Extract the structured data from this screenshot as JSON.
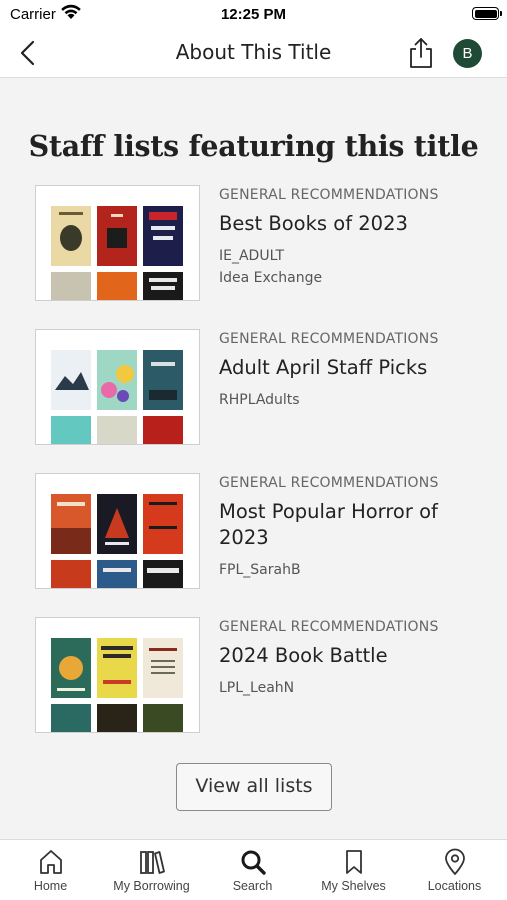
{
  "status_bar": {
    "carrier": "Carrier",
    "time": "12:25 PM"
  },
  "nav": {
    "title": "About This Title",
    "avatar_initial": "B"
  },
  "section": {
    "title": "Staff lists featuring this title"
  },
  "lists": [
    {
      "category": "GENERAL RECOMMENDATIONS",
      "title": "Best Books of 2023",
      "owner": "IE_ADULT",
      "owner_location": "Idea Exchange"
    },
    {
      "category": "GENERAL RECOMMENDATIONS",
      "title": "Adult April Staff Picks",
      "owner": "RHPLAdults"
    },
    {
      "category": "GENERAL RECOMMENDATIONS",
      "title": "Most Popular Horror of 2023",
      "owner": "FPL_SarahB"
    },
    {
      "category": "GENERAL RECOMMENDATIONS",
      "title": "2024 Book Battle",
      "owner": "LPL_LeahN"
    }
  ],
  "view_all_label": "View all lists",
  "tabs": [
    {
      "label": "Home",
      "icon": "home-icon"
    },
    {
      "label": "My Borrowing",
      "icon": "books-icon"
    },
    {
      "label": "Search",
      "icon": "search-icon"
    },
    {
      "label": "My Shelves",
      "icon": "bookmark-icon"
    },
    {
      "label": "Locations",
      "icon": "location-pin-icon"
    }
  ],
  "colors": {
    "avatar_bg": "#1f4a35",
    "page_bg": "#f3f3f3"
  }
}
